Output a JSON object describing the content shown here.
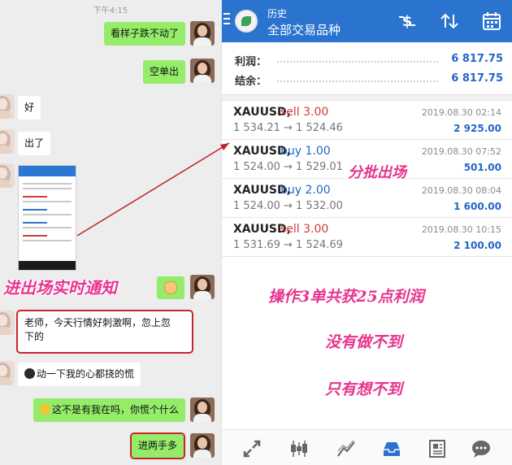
{
  "chat": {
    "time": "下午4:15",
    "messages": [
      {
        "text": "看样子跌不动了"
      },
      {
        "text": "空单出"
      },
      {
        "text": "好"
      },
      {
        "text": "出了"
      },
      {
        "text": "老师，今天行情好刺激啊，忽上忽"
      },
      {
        "text": "下的"
      },
      {
        "text": "动一下我的心都挠的慌"
      },
      {
        "text": "这不是有我在吗，你慌个什么"
      },
      {
        "text": "进两手多"
      }
    ]
  },
  "app": {
    "header": {
      "subtitle": "历史",
      "title": "全部交易品种"
    },
    "summary": [
      {
        "label": "利润：",
        "value": "6 817.75"
      },
      {
        "label": "结余：",
        "value": "6 817.75"
      }
    ],
    "deals": [
      {
        "symbol": "XAUUSD,",
        "side": "sell 3.00",
        "type": "sell",
        "prices": "1 534.21 → 1 524.46",
        "date": "2019.08.30 02:14",
        "profit": "2 925.00"
      },
      {
        "symbol": "XAUUSD,",
        "side": "buy 1.00",
        "type": "buy",
        "prices": "1 524.00 → 1 529.01",
        "date": "2019.08.30 07:52",
        "profit": "501.00"
      },
      {
        "symbol": "XAUUSD,",
        "side": "buy 2.00",
        "type": "buy",
        "prices": "1 524.00 → 1 532.00",
        "date": "2019.08.30 08:04",
        "profit": "1 600.00"
      },
      {
        "symbol": "XAUUSD,",
        "side": "sell 3.00",
        "type": "sell",
        "prices": "1 531.69 → 1 524.69",
        "date": "2019.08.30 10:15",
        "profit": "2 100.00"
      }
    ],
    "nav_icons": [
      "trade-icon",
      "chart-candles-icon",
      "quotes-icon",
      "history-icon",
      "news-icon",
      "chat-icon"
    ],
    "accent": "#2a74cf"
  },
  "annotations": {
    "left": "进出场实时通知",
    "middle": "分批出场",
    "line1": "操作3单共获25点利润",
    "line2": "没有做不到",
    "line3": "只有想不到",
    "color": "#e8338f"
  }
}
